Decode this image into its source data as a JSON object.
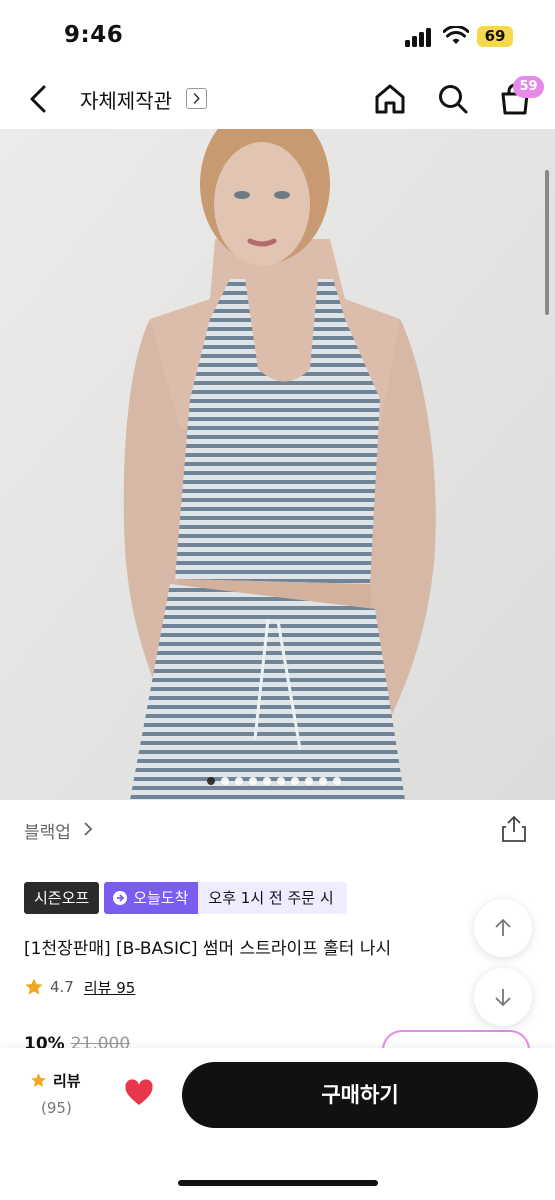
{
  "status_bar": {
    "time": "9:46",
    "battery": "69"
  },
  "nav": {
    "title": "자체제작관",
    "cart_count": "59"
  },
  "gallery": {
    "dot_count": 10,
    "active_index": 0
  },
  "product": {
    "brand": "블랙업",
    "tags": {
      "season": "시즌오프",
      "delivery": "오늘도착",
      "delivery_note": "오후 1시 전 주문 시"
    },
    "name": "[1천장판매] [B-BASIC] 썸머 스트라이프 홀터 나시",
    "rating": "4.7",
    "reviews_label": "리뷰 95",
    "discount": "10%",
    "original_price": "21,000"
  },
  "bottom_bar": {
    "review_label": "리뷰",
    "review_count": "(95)",
    "buy_label": "구매하기"
  },
  "colors": {
    "accent_purple": "#7b5cf0",
    "badge_pink": "#e58ae8",
    "heart_red": "#e8364a",
    "star": "#f0a81e"
  }
}
